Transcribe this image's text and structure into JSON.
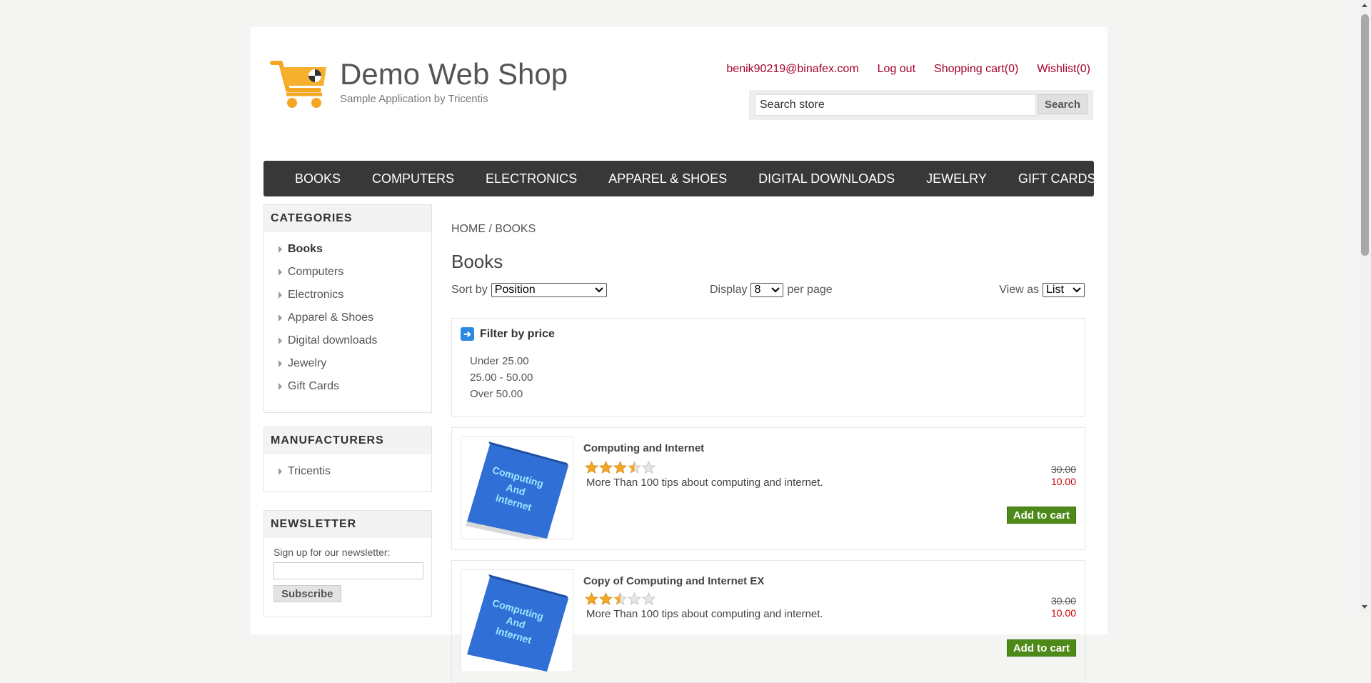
{
  "header": {
    "title": "Demo Web Shop",
    "subtitle": "Sample Application by Tricentis",
    "links": [
      "benik90219@binafex.com",
      "Log out",
      "Shopping cart(0)",
      "Wishlist(0)"
    ],
    "search_value": "Search store",
    "search_button": "Search",
    "logo_icon": "shopping-cart-icon",
    "accent_color": "#a5002c"
  },
  "menu": [
    "BOOKS",
    "COMPUTERS",
    "ELECTRONICS",
    "APPAREL & SHOES",
    "DIGITAL DOWNLOADS",
    "JEWELRY",
    "GIFT CARDS"
  ],
  "categories": {
    "title": "CATEGORIES",
    "items": [
      "Books",
      "Computers",
      "Electronics",
      "Apparel & Shoes",
      "Digital downloads",
      "Jewelry",
      "Gift Cards"
    ]
  },
  "manufacturers": {
    "title": "MANUFACTURERS",
    "items": [
      "Tricentis"
    ]
  },
  "newsletter": {
    "title": "NEWSLETTER",
    "label": "Sign up for our newsletter:",
    "button": "Subscribe"
  },
  "main": {
    "breadcrumb_home": "HOME",
    "breadcrumb_sep": "/",
    "breadcrumb_current": "BOOKS",
    "title": "Books",
    "sort_label": "Sort by",
    "sort_value": "Position",
    "display_label": "Display",
    "display_value": "8",
    "per_page": "per page",
    "view_label": "View as",
    "view_value": "List"
  },
  "filter": {
    "title": "Filter by price",
    "options": [
      "Under 25.00",
      "25.00 - 50.00",
      "Over 50.00"
    ]
  },
  "products": [
    {
      "title": "Computing and Internet",
      "rating": 3.5,
      "description": "More Than 100 tips about computing and internet.",
      "old_price": "30.00",
      "price": "10.00",
      "cart": "Add to cart",
      "image_text": "Computing And Internet"
    },
    {
      "title": "Copy of Computing and Internet EX",
      "rating": 2.5,
      "description": "More Than 100 tips about computing and internet.",
      "old_price": "30.00",
      "price": "10.00",
      "cart": "Add to cart",
      "image_text": "Computing And Internet"
    }
  ]
}
